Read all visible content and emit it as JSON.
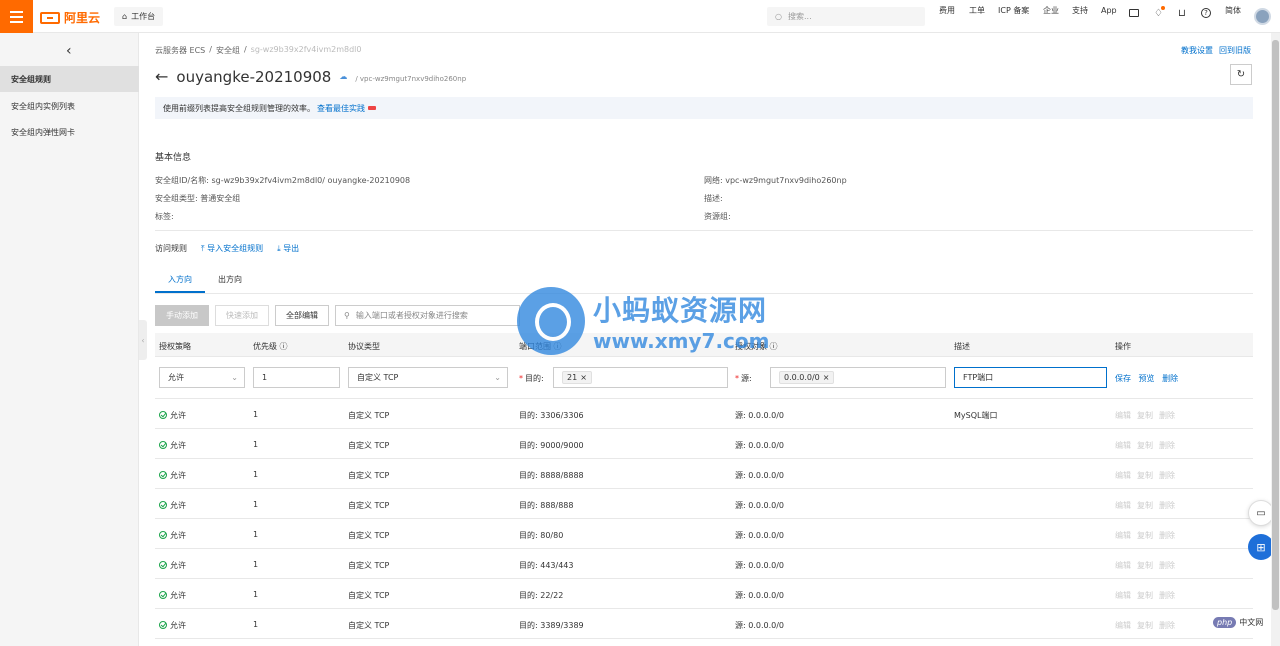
{
  "topbar": {
    "logo_text": "阿里云",
    "workbench": "工作台",
    "search_placeholder": "搜索...",
    "nav": [
      "费用",
      "工单",
      "ICP 备案",
      "企业",
      "支持",
      "App"
    ],
    "lang": "简体"
  },
  "sidebar": {
    "items": [
      "安全组规则",
      "安全组内实例列表",
      "安全组内弹性网卡"
    ]
  },
  "breadcrumb": [
    "云服务器 ECS",
    "安全组",
    "sg-wz9b39x2fv4ivm2m8dl0"
  ],
  "top_links": [
    "教我设置",
    "回到旧版"
  ],
  "header": {
    "title": "ouyangke-20210908",
    "vpc": "/ vpc-wz9mgut7nxv9diho260np"
  },
  "notice": {
    "text": "使用前缀列表提高安全组规则管理的效率。",
    "link": "查看最佳实践"
  },
  "basic_info": {
    "section_title": "基本信息",
    "id_name": "安全组ID/名称:  sg-wz9b39x2fv4ivm2m8dl0/ ouyangke-20210908",
    "type": "安全组类型:  普通安全组",
    "tags": "标签:",
    "network": "网络:  vpc-wz9mgut7nxv9diho260np",
    "description": "描述:",
    "resource_group": "资源组:"
  },
  "access_rules": {
    "label": "访问规则",
    "import": "导入安全组规则",
    "export": "导出"
  },
  "tabs": [
    "入方向",
    "出方向"
  ],
  "toolbar": {
    "manual_add": "手动添加",
    "quick_add": "快速添加",
    "edit_all": "全部编辑",
    "filter_placeholder": "输入端口或者授权对象进行搜索"
  },
  "table": {
    "columns": [
      "授权策略",
      "优先级",
      "协议类型",
      "端口范围",
      "授权对象",
      "描述",
      "操作"
    ],
    "edit_row": {
      "policy": "允许",
      "priority": "1",
      "protocol": "自定义 TCP",
      "dest_label": "目的:",
      "port_tag": "21",
      "source_label": "源:",
      "source_tag": "0.0.0.0/0",
      "description": "FTP端口",
      "actions": [
        "保存",
        "预览",
        "删除"
      ]
    },
    "rows": [
      {
        "policy": "允许",
        "priority": "1",
        "protocol": "自定义 TCP",
        "port": "目的: 3306/3306",
        "source": "源: 0.0.0.0/0",
        "desc": "MySQL端口"
      },
      {
        "policy": "允许",
        "priority": "1",
        "protocol": "自定义 TCP",
        "port": "目的: 9000/9000",
        "source": "源: 0.0.0.0/0",
        "desc": ""
      },
      {
        "policy": "允许",
        "priority": "1",
        "protocol": "自定义 TCP",
        "port": "目的: 8888/8888",
        "source": "源: 0.0.0.0/0",
        "desc": ""
      },
      {
        "policy": "允许",
        "priority": "1",
        "protocol": "自定义 TCP",
        "port": "目的: 888/888",
        "source": "源: 0.0.0.0/0",
        "desc": ""
      },
      {
        "policy": "允许",
        "priority": "1",
        "protocol": "自定义 TCP",
        "port": "目的: 80/80",
        "source": "源: 0.0.0.0/0",
        "desc": ""
      },
      {
        "policy": "允许",
        "priority": "1",
        "protocol": "自定义 TCP",
        "port": "目的: 443/443",
        "source": "源: 0.0.0.0/0",
        "desc": ""
      },
      {
        "policy": "允许",
        "priority": "1",
        "protocol": "自定义 TCP",
        "port": "目的: 22/22",
        "source": "源: 0.0.0.0/0",
        "desc": ""
      },
      {
        "policy": "允许",
        "priority": "1",
        "protocol": "自定义 TCP",
        "port": "目的: 3389/3389",
        "source": "源: 0.0.0.0/0",
        "desc": ""
      }
    ],
    "row_actions": [
      "编辑",
      "复制",
      "删除"
    ]
  },
  "watermark": {
    "cn": "小蚂蚁资源网",
    "en": "www.xmy7.com"
  },
  "php_badge": {
    "pill": "php",
    "text": "中文网"
  },
  "colors": {
    "brand": "#ff6a00",
    "link": "#0070cc",
    "allow": "#1aa34a"
  }
}
